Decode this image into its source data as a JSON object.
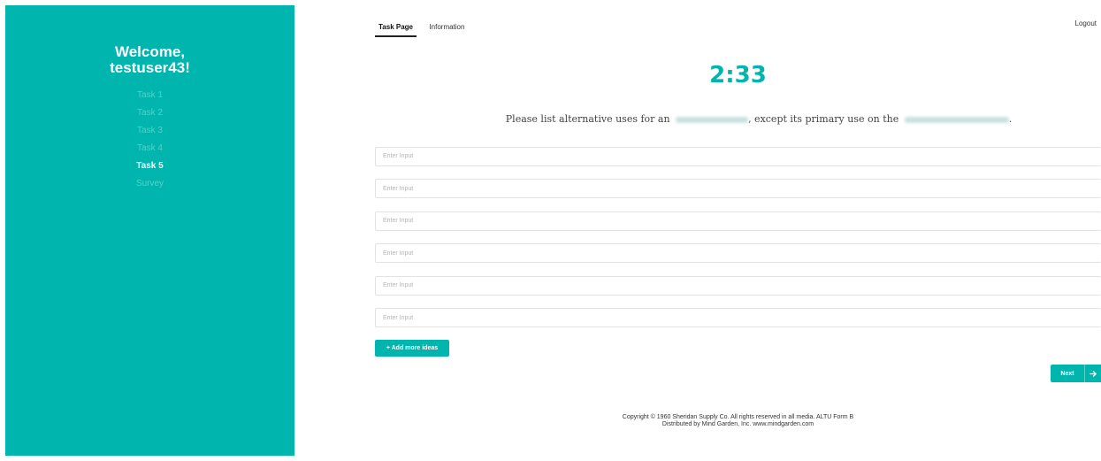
{
  "sidebar": {
    "welcome_line1": "Welcome,",
    "welcome_line2": "testuser43!",
    "items": [
      {
        "label": "Task 1",
        "active": false
      },
      {
        "label": "Task 2",
        "active": false
      },
      {
        "label": "Task 3",
        "active": false
      },
      {
        "label": "Task 4",
        "active": false
      },
      {
        "label": "Task 5",
        "active": true
      },
      {
        "label": "Survey",
        "active": false
      }
    ]
  },
  "header": {
    "tabs": [
      {
        "label": "Task Page",
        "active": true
      },
      {
        "label": "Information",
        "active": false
      }
    ],
    "logout_label": "Logout"
  },
  "timer": "2:33",
  "prompt": {
    "part1": "Please list alternative uses for an",
    "part2": ", except its primary use on the",
    "part3": "."
  },
  "inputs": [
    {
      "value": "",
      "placeholder": "Enter Input"
    },
    {
      "value": "",
      "placeholder": "Enter Input"
    },
    {
      "value": "",
      "placeholder": "Enter Input"
    },
    {
      "value": "",
      "placeholder": "Enter Input"
    },
    {
      "value": "",
      "placeholder": "Enter Input"
    },
    {
      "value": "",
      "placeholder": "Enter Input"
    }
  ],
  "buttons": {
    "add_label": "+ Add more ideas",
    "next_label": "Next",
    "next_icon": "arrow-right-icon"
  },
  "footer": {
    "line1": "Copyright © 1960 Sheridan Supply Co. All rights reserved in all media. ALTU Form B",
    "line2": "Distributed by Mind Garden, Inc. www.mindgarden.com"
  },
  "colors": {
    "accent": "#00b5ad",
    "text": "#333333"
  }
}
